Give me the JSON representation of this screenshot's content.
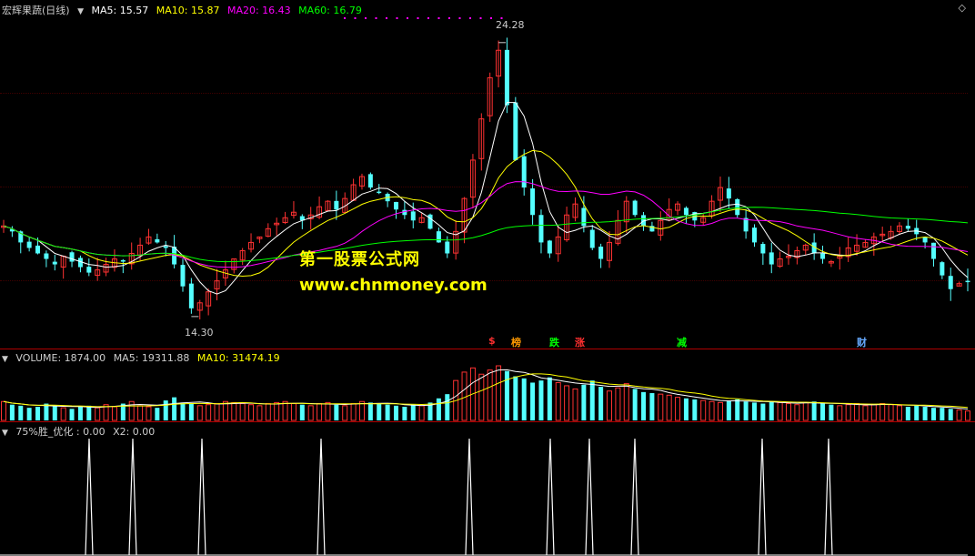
{
  "stock": {
    "name": "宏辉果蔬(日线)",
    "ma5_label": "MA5: 15.57",
    "ma10_label": "MA10: 15.87",
    "ma20_label": "MA20: 16.43",
    "ma60_label": "MA60: 16.79",
    "high_label": "24.28",
    "low_label": "14.30"
  },
  "volume": {
    "vol_label": "VOLUME: 1874.00",
    "ma5_label": "MA5: 19311.88",
    "ma10_label": "MA10: 31474.19"
  },
  "indicator": {
    "name_label": "75%胜_优化 : 0.00",
    "x2_label": "X2: 0.00"
  },
  "watermark": {
    "line1": "第一股票公式网",
    "line2": "www.chnmoney.com"
  },
  "events": [
    {
      "text": "$",
      "color": "#ff3030"
    },
    {
      "text": "榜",
      "color": "#ff9900"
    },
    {
      "text": "跌",
      "color": "#00ff00"
    },
    {
      "text": "涨",
      "color": "#ff3030"
    },
    {
      "text": "减",
      "color": "#00ff00"
    },
    {
      "text": "财",
      "color": "#66aaff"
    }
  ],
  "colors": {
    "up": "#ff3232",
    "down": "#54ffff",
    "ma5": "#ffffff",
    "ma10": "#ffff00",
    "ma20": "#ff00ff",
    "ma60": "#00ff00",
    "signal": "#ffffff",
    "axis": "#b00000"
  },
  "chart_data": [
    {
      "type": "candlestick",
      "title": "宏辉果蔬(日线)",
      "ylim": [
        13.5,
        25.5
      ],
      "price_high": 24.28,
      "price_low": 14.3,
      "series": [
        {
          "name": "MA5",
          "last": 15.57
        },
        {
          "name": "MA10",
          "last": 15.87
        },
        {
          "name": "MA20",
          "last": 16.43
        },
        {
          "name": "MA60",
          "last": 16.79
        }
      ],
      "closes": [
        17.6,
        17.4,
        17.0,
        16.8,
        16.6,
        16.4,
        16.2,
        16.5,
        16.3,
        16.1,
        15.9,
        16.0,
        16.2,
        16.4,
        16.3,
        16.6,
        16.9,
        17.2,
        17.0,
        16.8,
        16.2,
        15.4,
        14.6,
        14.8,
        15.2,
        15.6,
        16.0,
        16.4,
        16.7,
        17.0,
        17.2,
        17.5,
        17.7,
        17.9,
        18.1,
        17.8,
        18.0,
        18.3,
        18.5,
        18.2,
        18.6,
        19.1,
        19.4,
        19.0,
        18.8,
        18.5,
        18.2,
        18.0,
        17.8,
        17.9,
        17.5,
        17.0,
        16.6,
        17.4,
        18.6,
        20.0,
        21.5,
        23.0,
        24.0,
        22.0,
        20.0,
        19.0,
        18.0,
        17.0,
        16.6,
        17.2,
        18.0,
        18.4,
        17.6,
        16.8,
        16.4,
        17.0,
        17.8,
        18.5,
        18.0,
        17.6,
        17.4,
        17.8,
        18.2,
        18.4,
        18.0,
        17.8,
        17.9,
        18.5,
        19.0,
        18.6,
        18.0,
        17.4,
        17.0,
        16.6,
        16.2,
        16.4,
        16.5,
        16.7,
        16.9,
        16.6,
        16.4,
        16.3,
        16.5,
        16.8,
        16.9,
        17.0,
        17.2,
        17.3,
        17.4,
        17.6,
        17.5,
        17.3,
        17.0,
        16.4,
        15.8,
        15.3,
        15.5,
        15.6
      ],
      "note": "closing prices sampled left to right (approximate)"
    },
    {
      "type": "bar",
      "title": "VOLUME",
      "series": [
        {
          "name": "VOLUME",
          "last": 1874.0
        },
        {
          "name": "MA5",
          "last": 19311.88
        },
        {
          "name": "MA10",
          "last": 31474.19
        }
      ],
      "values": [
        18,
        15,
        14,
        12,
        13,
        16,
        14,
        12,
        11,
        13,
        14,
        12,
        15,
        13,
        16,
        18,
        14,
        13,
        12,
        19,
        22,
        17,
        16,
        14,
        15,
        16,
        18,
        17,
        16,
        15,
        14,
        16,
        17,
        18,
        16,
        15,
        14,
        16,
        17,
        15,
        14,
        16,
        18,
        17,
        16,
        15,
        14,
        13,
        15,
        14,
        17,
        21,
        25,
        38,
        46,
        50,
        44,
        48,
        52,
        47,
        42,
        40,
        36,
        38,
        41,
        36,
        33,
        30,
        34,
        38,
        32,
        28,
        31,
        35,
        30,
        27,
        26,
        25,
        24,
        22,
        21,
        20,
        19,
        18,
        17,
        19,
        20,
        18,
        17,
        16,
        18,
        17,
        16,
        15,
        17,
        18,
        16,
        15,
        14,
        15,
        16,
        14,
        15,
        16,
        15,
        14,
        13,
        14,
        13,
        12,
        12,
        11,
        10,
        9
      ]
    },
    {
      "type": "line",
      "title": "75%胜_优化",
      "series": [
        {
          "name": "75%胜_优化",
          "last": 0.0
        },
        {
          "name": "X2",
          "last": 0.0
        }
      ],
      "signal_positions": [
        98,
        146,
        222,
        353,
        516,
        605,
        648,
        698,
        838,
        911
      ],
      "signal_value": 1
    }
  ]
}
